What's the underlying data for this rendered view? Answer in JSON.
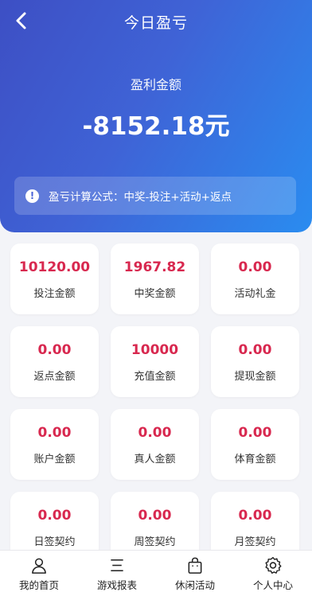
{
  "header": {
    "title": "今日盈亏",
    "back_icon": "chevron-left-icon"
  },
  "summary": {
    "label": "盈利金额",
    "value": "-8152.18元",
    "formula_icon": "info-icon",
    "formula_icon_glyph": "!",
    "formula_text": "盈亏计算公式：中奖-投注+活动+返点"
  },
  "stats": [
    {
      "value": "10120.00",
      "label": "投注金额"
    },
    {
      "value": "1967.82",
      "label": "中奖金额"
    },
    {
      "value": "0.00",
      "label": "活动礼金"
    },
    {
      "value": "0.00",
      "label": "返点金额"
    },
    {
      "value": "10000",
      "label": "充值金额"
    },
    {
      "value": "0.00",
      "label": "提现金额"
    },
    {
      "value": "0.00",
      "label": "账户金额"
    },
    {
      "value": "0.00",
      "label": "真人金额"
    },
    {
      "value": "0.00",
      "label": "体育金额"
    },
    {
      "value": "0.00",
      "label": "日签契约"
    },
    {
      "value": "0.00",
      "label": "周签契约"
    },
    {
      "value": "0.00",
      "label": "月签契约"
    }
  ],
  "tabbar": [
    {
      "label": "我的首页",
      "icon": "user-icon"
    },
    {
      "label": "游戏报表",
      "icon": "list-icon"
    },
    {
      "label": "休闲活动",
      "icon": "shopping-bag-icon"
    },
    {
      "label": "个人中心",
      "icon": "gear-icon"
    }
  ],
  "colors": {
    "accent_value": "#d8284f",
    "hero_gradient_start": "#3d4fc4",
    "hero_gradient_end": "#2a8cf0"
  }
}
